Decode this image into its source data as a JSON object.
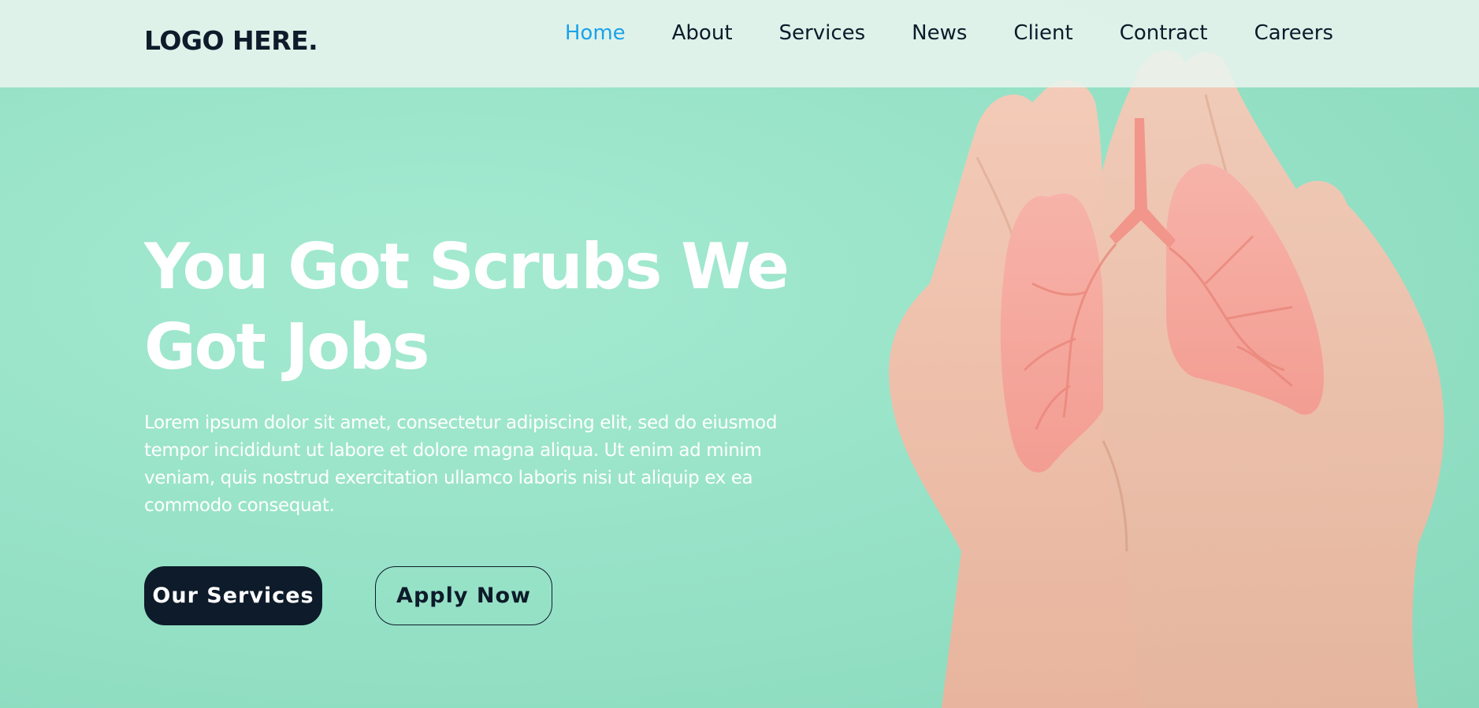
{
  "brand": {
    "logo_text": "LOGO HERE."
  },
  "nav": {
    "items": [
      {
        "label": "Home",
        "active": true
      },
      {
        "label": "About",
        "active": false
      },
      {
        "label": "Services",
        "active": false
      },
      {
        "label": "News",
        "active": false
      },
      {
        "label": "Client",
        "active": false
      },
      {
        "label": "Contract",
        "active": false
      },
      {
        "label": "Careers",
        "active": false
      }
    ]
  },
  "hero": {
    "headline_line1": "You Got Scrubs We",
    "headline_line2": "Got Jobs",
    "body": "Lorem ipsum dolor sit amet, consectetur adipiscing elit, sed do eiusmod tempor incididunt ut labore et dolore magna aliqua. Ut enim ad minim veniam, quis nostrud exercitation ullamco laboris nisi ut aliquip ex ea commodo consequat.",
    "primary_button": "Our Services",
    "secondary_button": "Apply Now",
    "image_subject": "hands-holding-paper-lungs"
  },
  "colors": {
    "background": "#9ee6cc",
    "dark": "#0d1b2a",
    "accent": "#1ba3e8",
    "white": "#ffffff",
    "lung": "#f4a59b"
  }
}
